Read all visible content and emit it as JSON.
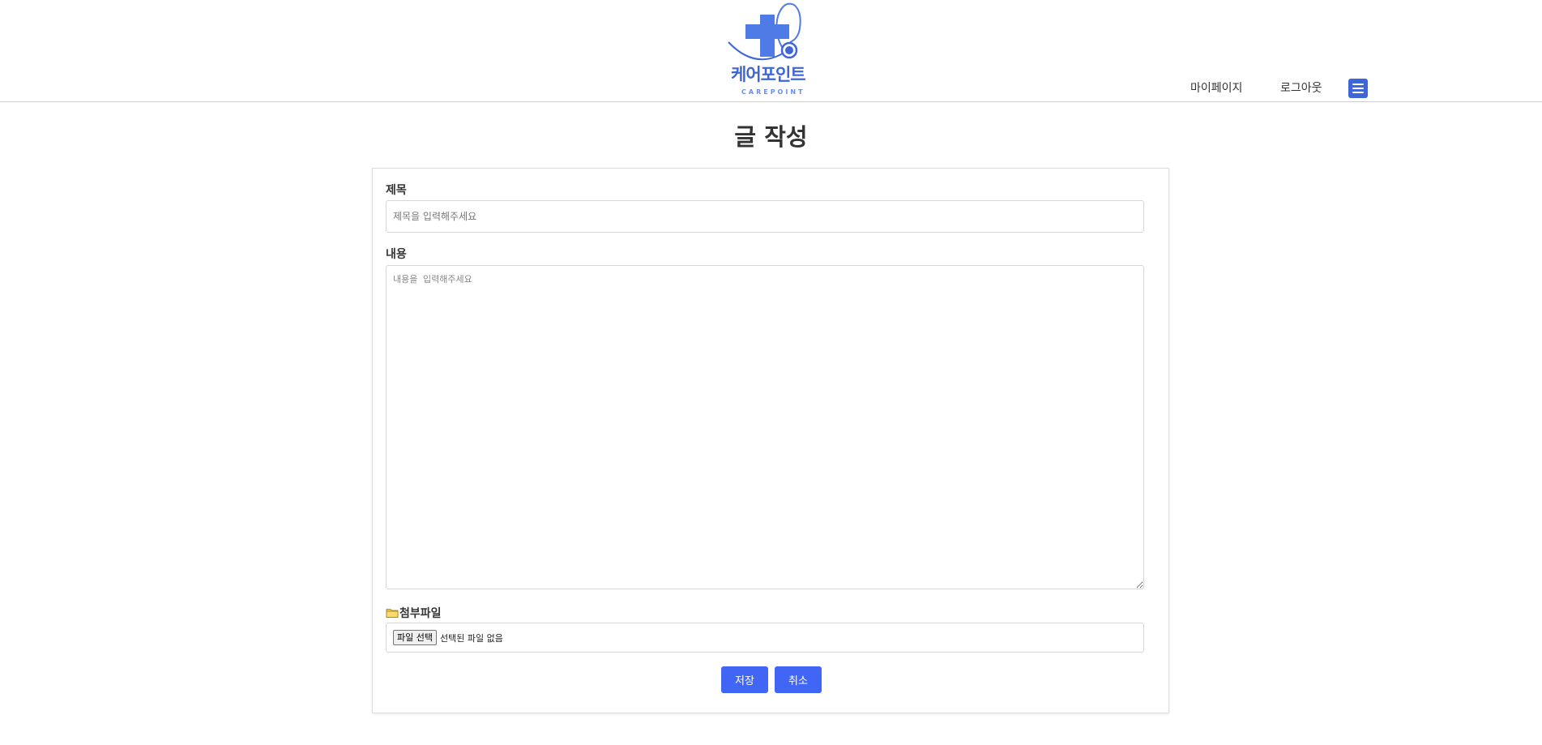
{
  "header": {
    "logo": {
      "text_ko": "케어포인트",
      "text_en": "CAREPOINT",
      "brand_color": "#3f66d8",
      "icon": "medical-cross-stethoscope-icon"
    },
    "nav": {
      "mypage_label": "마이페이지",
      "logout_label": "로그아웃",
      "menu_icon": "hamburger-menu-icon"
    }
  },
  "page": {
    "title": "글 작성"
  },
  "form": {
    "title_label": "제목",
    "title_placeholder": "제목을 입력해주세요",
    "title_value": "",
    "content_label": "내용",
    "content_placeholder": "내용을 입력해주세요",
    "content_value": "",
    "file_label": "첨부파일",
    "file_icon": "folder-icon",
    "file_button_label": "파일 선택",
    "file_status": "선택된 파일 없음",
    "save_label": "저장",
    "cancel_label": "취소"
  },
  "colors": {
    "accent": "#4166f5",
    "border": "#d6d6d6"
  }
}
